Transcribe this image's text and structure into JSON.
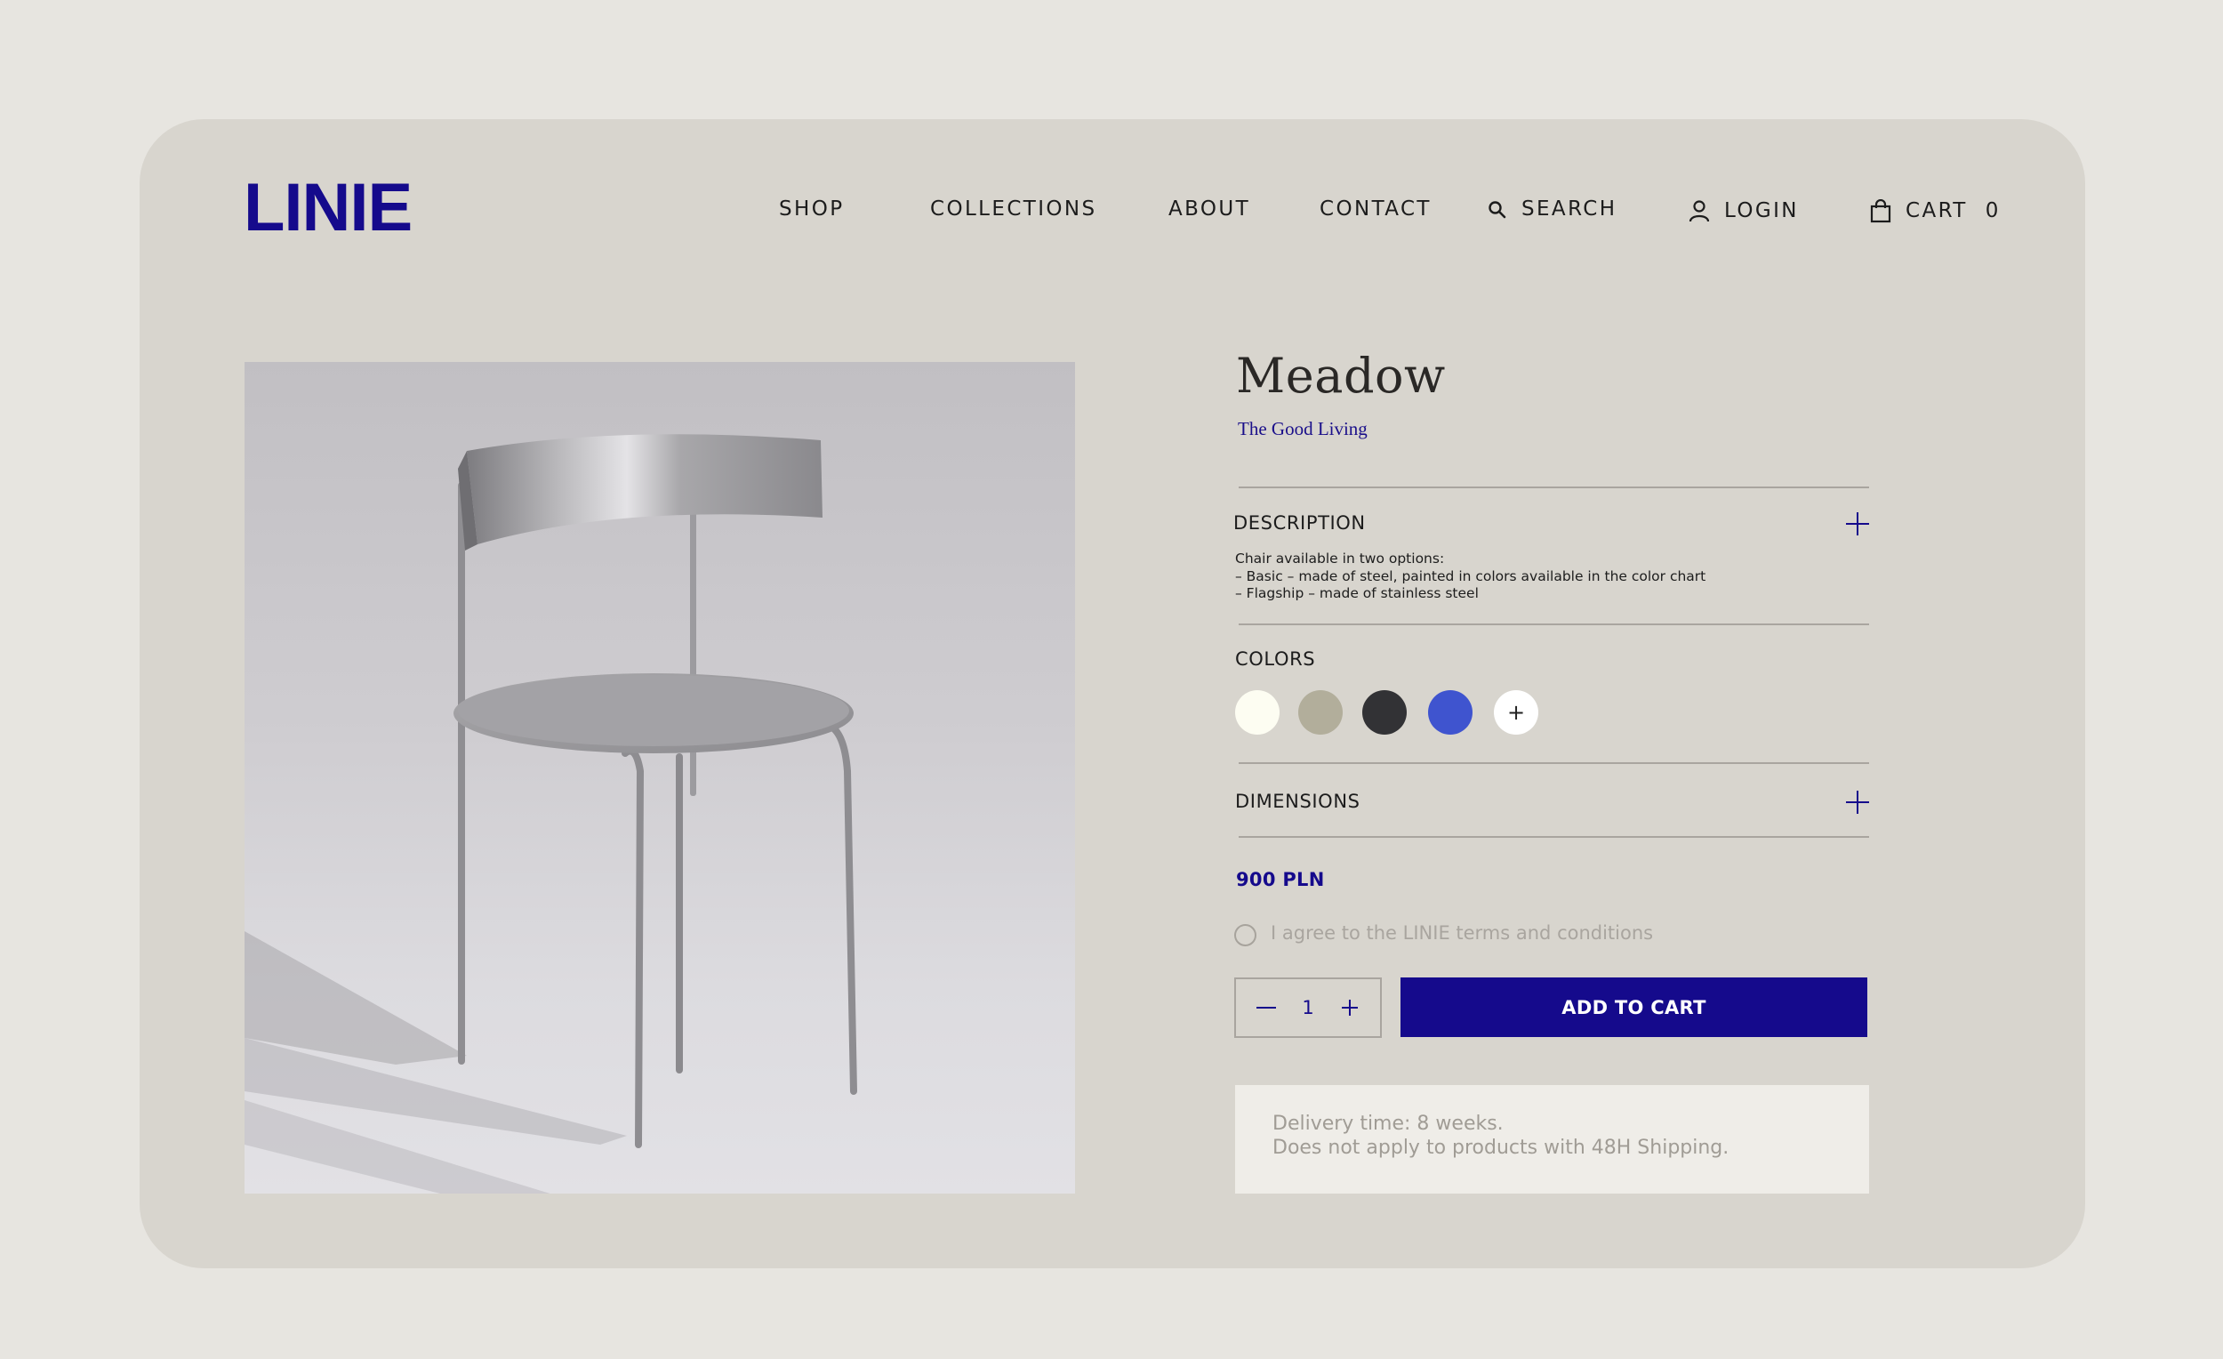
{
  "brand": {
    "logo_text": "LINIE",
    "accent_color": "#150a8c"
  },
  "nav": {
    "shop": "SHOP",
    "collections": "COLLECTIONS",
    "about": "ABOUT",
    "contact": "CONTACT",
    "search": "SEARCH",
    "login": "LOGIN",
    "cart": "CART",
    "cart_count": "0"
  },
  "product": {
    "name": "Meadow",
    "collection": "The Good Living",
    "image_alt_icon": "chair-photo",
    "description": {
      "label": "DESCRIPTION",
      "lines": [
        "Chair available in two options:",
        "– Basic – made of steel, painted in colors available in the color chart",
        "– Flagship – made of stainless steel"
      ]
    },
    "colors": {
      "label": "COLORS",
      "swatches": [
        "#fdfdf2",
        "#b2ae9b",
        "#323235",
        "#3f54cf"
      ],
      "more_symbol": "+"
    },
    "dimensions": {
      "label": "DIMENSIONS"
    },
    "price": "900 PLN",
    "terms_label": "I agree to the LINIE terms and conditions",
    "quantity": "1",
    "add_to_cart_label": "ADD TO CART",
    "delivery": {
      "line1": "Delivery time: 8 weeks.",
      "line2": "Does not apply to products with 48H Shipping."
    }
  }
}
